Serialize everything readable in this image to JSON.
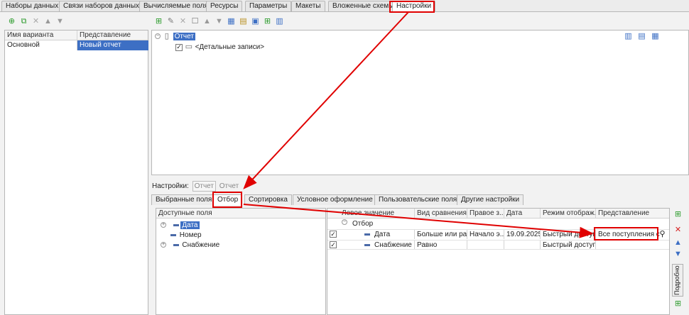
{
  "top_tabs": [
    "Наборы данных",
    "Связи наборов данных",
    "Вычисляемые поля",
    "Ресурсы",
    "Параметры",
    "Макеты",
    "Вложенные схемы",
    "Настройки"
  ],
  "variants": {
    "headers": [
      "Имя варианта",
      "Представление"
    ],
    "rows": [
      {
        "name": "Основной",
        "presentation": "Новый отчет"
      }
    ]
  },
  "structure": {
    "root_label": "Отчет",
    "child_label": "<Детальные записи>"
  },
  "settings_bar": {
    "label": "Настройки:",
    "crumb1": "Отчет",
    "crumb2": "Отчет"
  },
  "sub_tabs": [
    "Выбранные поля",
    "Отбор",
    "Сортировка",
    "Условное оформление",
    "Пользовательские поля",
    "Другие настройки"
  ],
  "available_fields": {
    "header": "Доступные поля",
    "items": [
      {
        "label": "Дата",
        "expandable": true,
        "selected": true
      },
      {
        "label": "Номер",
        "expandable": false,
        "selected": false
      },
      {
        "label": "Снабжение",
        "expandable": true,
        "selected": false
      }
    ]
  },
  "filter_table": {
    "headers": [
      "Левое значение",
      "Вид сравнения",
      "Правое з...",
      "Дата",
      "Режим отображ...",
      "Представление"
    ],
    "group_label": "Отбор",
    "rows": [
      {
        "left": "Дата",
        "comparison": "Больше или рав...",
        "right": "Начало э...",
        "date": "19.09.2025...",
        "mode": "Быстрый доступ",
        "presentation": "Все поступления с"
      },
      {
        "left": "Снабжение",
        "comparison": "Равно",
        "right": "",
        "date": "",
        "mode": "Быстрый доступ",
        "presentation": ""
      }
    ]
  },
  "side_tab_label": "Подробно",
  "colors": {
    "highlight": "#e00000",
    "selection": "#3d6fc4",
    "arrow": "#e00000"
  }
}
